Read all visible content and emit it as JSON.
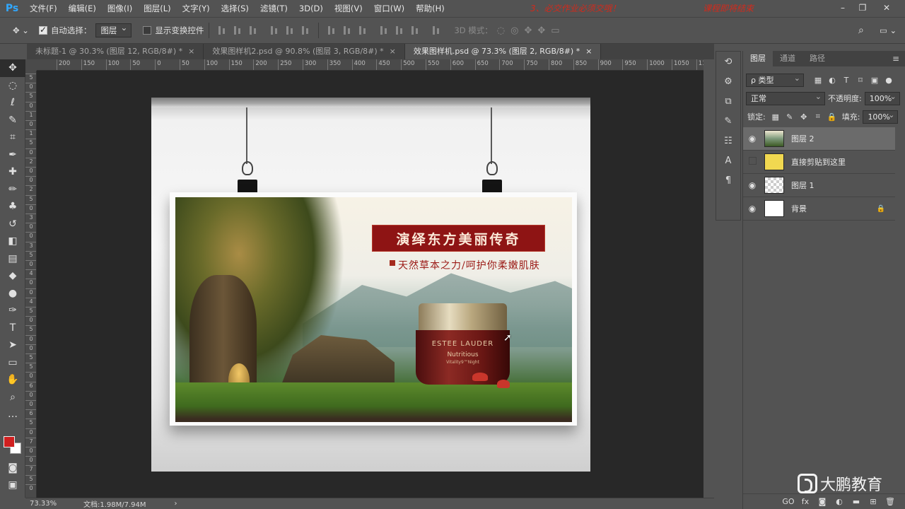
{
  "app": {
    "logo": "Ps"
  },
  "menu": [
    "文件(F)",
    "编辑(E)",
    "图像(I)",
    "图层(L)",
    "文字(Y)",
    "选择(S)",
    "滤镜(T)",
    "3D(D)",
    "视图(V)",
    "窗口(W)",
    "帮助(H)"
  ],
  "notices": [
    "3、必交作业必须交哦！",
    "课程即将结束"
  ],
  "options": {
    "auto_select_label": "自动选择：",
    "auto_select_value": "图层",
    "show_transform_label": "显示变换控件",
    "mode_3d_label": "3D 模式："
  },
  "tabs": [
    {
      "label": "未标题-1 @ 30.3% (图层 12, RGB/8#) *",
      "close": "×"
    },
    {
      "label": "效果图样机2.psd @ 90.8% (图层 3, RGB/8#) *",
      "close": "×"
    },
    {
      "label": "效果图样机.psd @ 73.3% (图层 2, RGB/8#) *",
      "close": "×"
    }
  ],
  "ruler_h": [
    "200",
    "150",
    "100",
    "50",
    "0",
    "50",
    "100",
    "150",
    "200",
    "250",
    "300",
    "350",
    "400",
    "450",
    "500",
    "550",
    "600",
    "650",
    "700",
    "750",
    "800",
    "850",
    "900",
    "950",
    "1000",
    "1050",
    "1100"
  ],
  "ruler_v": [
    "5",
    "0",
    "5",
    "0",
    "1",
    "0",
    "1",
    "5",
    "0",
    "2",
    "0",
    "0",
    "2",
    "5",
    "0",
    "3",
    "0",
    "0",
    "3",
    "5",
    "0",
    "4",
    "0",
    "0",
    "4",
    "5",
    "0",
    "5",
    "0",
    "0",
    "5",
    "5",
    "0",
    "6",
    "0",
    "0",
    "6",
    "5",
    "0",
    "7",
    "0",
    "0",
    "7",
    "5",
    "0"
  ],
  "poster": {
    "title": "演绎东方美丽传奇",
    "subtitle": "天然草本之力/呵护你柔嫩肌肤",
    "jar_brand": "ESTEE LAUDER",
    "jar_name": "Nutritious",
    "jar_sub": "Vitality9™Night"
  },
  "panel": {
    "tabs": [
      "图层",
      "通道",
      "路径"
    ],
    "menu_icon": "≡",
    "filter_kind": "ρ 类型",
    "blend_mode": "正常",
    "opacity_label": "不透明度:",
    "opacity_value": "100%",
    "lock_label": "锁定:",
    "fill_label": "填充:",
    "fill_value": "100%",
    "layers": [
      {
        "name": "图层 2",
        "visible": true,
        "selected": true,
        "thumb": "photo"
      },
      {
        "name": "直接剪贴到这里",
        "visible": false,
        "selected": false,
        "thumb": "yellow"
      },
      {
        "name": "图层 1",
        "visible": true,
        "selected": false,
        "thumb": "checker"
      },
      {
        "name": "背景",
        "visible": true,
        "selected": false,
        "thumb": "white",
        "locked": true
      }
    ],
    "bottom_icons": [
      "GO",
      "fx"
    ]
  },
  "watermark": {
    "text": "大鹏教育"
  },
  "status": {
    "zoom": "73.33%",
    "doc_info": "文档:1.98M/7.94M",
    "arrow": "›"
  },
  "colors": {
    "foreground": "#d01f1f",
    "background": "#ffffff",
    "accent": "#31a8ff"
  }
}
